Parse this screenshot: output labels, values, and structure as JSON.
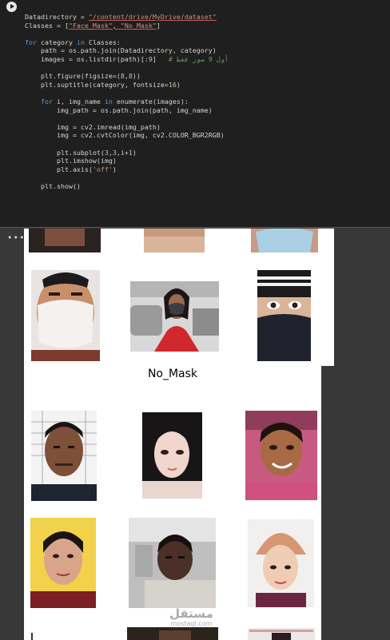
{
  "code_cell": {
    "lines": {
      "l1a": "Datadirectory = ",
      "l1b": "\"/content/drive/MyDrive/dataset\"",
      "l2a": "Classes = [",
      "l2b": "\"Face_Mask\"",
      "l2c": ", ",
      "l2d": "\"No_Mask\"",
      "l2e": "]",
      "l4a": "for",
      "l4b": " category ",
      "l4c": "in",
      "l4d": " Classes:",
      "l5": "    path = os.path.join(Datadirectory, category)",
      "l6a": "    images = os.listdir(path)[:",
      "l6b": "9",
      "l6c": "]   ",
      "l6d": "# أول 9 صور فقط",
      "l8a": "    plt.figure(figsize=(",
      "l8b": "8",
      "l8c": ",",
      "l8d": "8",
      "l8e": "))",
      "l9a": "    plt.suptitle(category, fontsize=",
      "l9b": "16",
      "l9c": ")",
      "l11a": "    ",
      "l11b": "for",
      "l11c": " i, img_name ",
      "l11d": "in",
      "l11e": " enumerate(images):",
      "l12": "        img_path = os.path.join(path, img_name)",
      "l14": "        img = cv2.imread(img_path)",
      "l15": "        img = cv2.cvtColor(img, cv2.COLOR_BGR2RGB)",
      "l17a": "        plt.subplot(",
      "l17b": "3",
      "l17c": ",",
      "l17d": "3",
      "l17e": ",i+",
      "l17f": "1",
      "l17g": ")",
      "l18": "        plt.imshow(img)",
      "l19a": "        plt.axis(",
      "l19b": "'off'",
      "l19c": ")",
      "l21": "    plt.show()"
    }
  },
  "output": {
    "menu_glyph": "•••",
    "figure2_title": "No_Mask"
  },
  "watermark": {
    "arabic": "مستقل",
    "latin": "mostaql.com"
  },
  "colors": {
    "editor_bg": "#1f1f1f",
    "keyword": "#569cd6",
    "string": "#ce9178",
    "number": "#b5cea8",
    "comment": "#6a9955"
  }
}
